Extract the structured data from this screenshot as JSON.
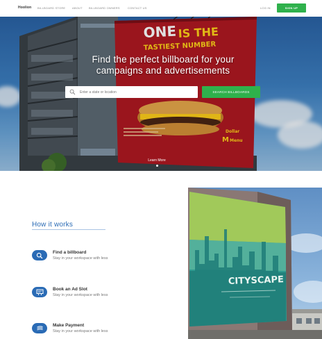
{
  "nav": {
    "logo": "Hoolion",
    "links": [
      "BILLBOARD STORE",
      "ABOUT",
      "BILLBOARD OWNERS",
      "CONTACT US"
    ],
    "login": "LOG IN",
    "signup": "SIGN UP"
  },
  "hero": {
    "title_line1": "Find the perfect billboard for your",
    "title_line2": "campaigns and advertisements",
    "search_placeholder": "Enter a state or location",
    "search_button": "SEARCH BILLBOARDS",
    "learn_more": "Learn More",
    "billboard_ad": {
      "headline_one": "ONE",
      "headline_is": "IS THE",
      "headline_tastiest": "TASTIEST NUMBER",
      "brand_line1": "Dollar",
      "brand_line2": "Menu"
    }
  },
  "how_it_works": {
    "title": "How it works",
    "steps": [
      {
        "title": "Find a billboard",
        "desc": "Stay in your workspace with less",
        "icon": "search-icon"
      },
      {
        "title": "Book an Ad Slot",
        "desc": "Stay in your workspace with less",
        "icon": "billboard-icon"
      },
      {
        "title": "Make Payment",
        "desc": "Stay in your workspace with less",
        "icon": "payment-icon"
      }
    ]
  },
  "cityscape_ad": {
    "title": "CITYSCAPE"
  },
  "colors": {
    "brand_green": "#2fb14c",
    "brand_blue": "#2a6bb5",
    "billboard_red": "#b01822",
    "billboard_yellow": "#ffd21a"
  }
}
